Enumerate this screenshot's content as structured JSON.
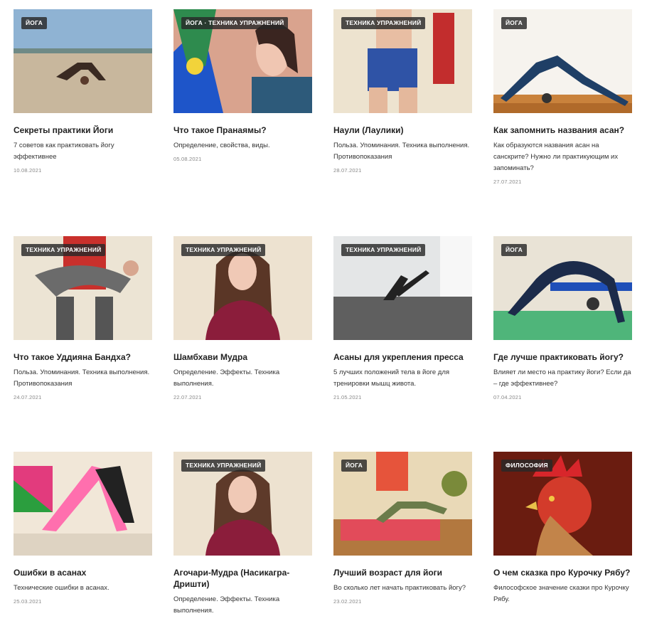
{
  "cards": [
    {
      "tag": "ЙОГА",
      "title": "Секреты практики Йоги",
      "desc": "7 советов как практиковать йогу эффективнее",
      "date": "10.08.2021"
    },
    {
      "tag": "ЙОГА · ТЕХНИКА УПРАЖНЕНИЙ",
      "title": "Что такое Пранаямы?",
      "desc": "Определение, свойства, виды.",
      "date": "05.08.2021"
    },
    {
      "tag": "ТЕХНИКА УПРАЖНЕНИЙ",
      "title": "Наули (Лаулики)",
      "desc": "Польза. Упоминания. Техника выполнения. Противопоказания",
      "date": "28.07.2021"
    },
    {
      "tag": "ЙОГА",
      "title": "Как запомнить названия асан?",
      "desc": "Как образуются названия асан на санскрите? Нужно ли практикующим их запоминать?",
      "date": "27.07.2021"
    },
    {
      "tag": "ТЕХНИКА УПРАЖНЕНИЙ",
      "title": "Что такое Уддияна Бандха?",
      "desc": "Польза. Упоминания. Техника выполнения. Противопоказания",
      "date": "24.07.2021"
    },
    {
      "tag": "ТЕХНИКА УПРАЖНЕНИЙ",
      "title": "Шамбхави Мудра",
      "desc": "Определение. Эффекты. Техника выполнения.",
      "date": "22.07.2021"
    },
    {
      "tag": "ТЕХНИКА УПРАЖНЕНИЙ",
      "title": "Асаны для укрепления пресса",
      "desc": "5 лучших положений тела в йоге для тренировки мышц живота.",
      "date": "21.05.2021"
    },
    {
      "tag": "ЙОГА",
      "title": "Где лучше практиковать йогу?",
      "desc": "Влияет ли место на практику йоги? Если да – где эффективнее?",
      "date": "07.04.2021"
    },
    {
      "tag": "",
      "title": "Ошибки в асанах",
      "desc": "Технические ошибки в асанах.",
      "date": "25.03.2021"
    },
    {
      "tag": "ТЕХНИКА УПРАЖНЕНИЙ",
      "title": "Агочари-Мудра (Насикагра-Дришти)",
      "desc": "Определение. Эффекты. Техника выполнения.",
      "date": ""
    },
    {
      "tag": "ЙОГА",
      "title": "Лучший возраст для йоги",
      "desc": "Во сколько лет начать практиковать йогу?",
      "date": "23.02.2021"
    },
    {
      "tag": "ФИЛОСОФИЯ",
      "title": "О чем сказка про Курочку Рябу?",
      "desc": "Философское значение сказки про Курочку Рябу.",
      "date": ""
    }
  ]
}
